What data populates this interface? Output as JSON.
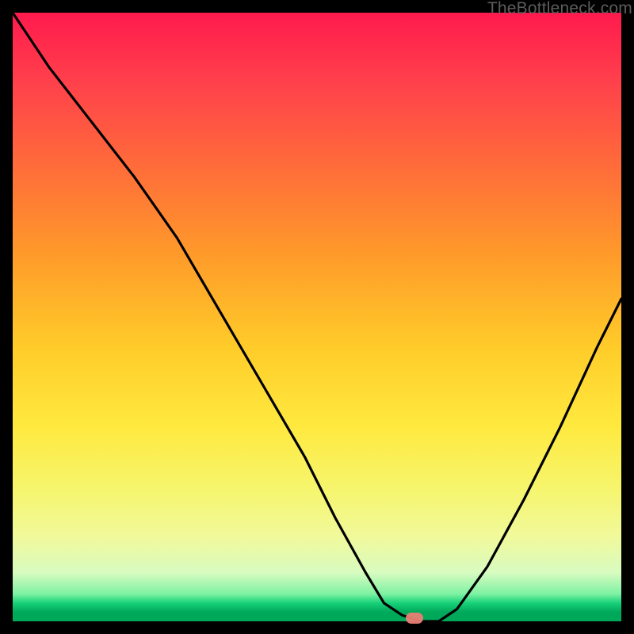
{
  "watermark": "TheBottleneck.com",
  "colors": {
    "marker": "#e98075",
    "curve_stroke": "#000000"
  },
  "chart_data": {
    "type": "line",
    "title": "",
    "xlabel": "",
    "ylabel": "",
    "xlim": [
      0,
      100
    ],
    "ylim": [
      0,
      100
    ],
    "grid": false,
    "legend": false,
    "series": [
      {
        "name": "bottleneck-curve",
        "x": [
          0,
          6,
          13,
          20,
          27,
          34,
          41,
          48,
          53,
          58,
          61,
          64,
          67,
          70,
          73,
          78,
          84,
          90,
          96,
          100
        ],
        "values": [
          100,
          91,
          82,
          73,
          63,
          51,
          39,
          27,
          17,
          8,
          3,
          1,
          0,
          0,
          2,
          9,
          20,
          32,
          45,
          53
        ]
      }
    ],
    "marker": {
      "x": 66,
      "y": 0.5
    },
    "background_gradient": [
      {
        "pct": 0,
        "color": "#ff1a4d"
      },
      {
        "pct": 25,
        "color": "#ff6b3a"
      },
      {
        "pct": 55,
        "color": "#ffcc29"
      },
      {
        "pct": 78,
        "color": "#f6f56c"
      },
      {
        "pct": 92,
        "color": "#d8fbc0"
      },
      {
        "pct": 97,
        "color": "#17d178"
      },
      {
        "pct": 100,
        "color": "#00a85a"
      }
    ]
  }
}
